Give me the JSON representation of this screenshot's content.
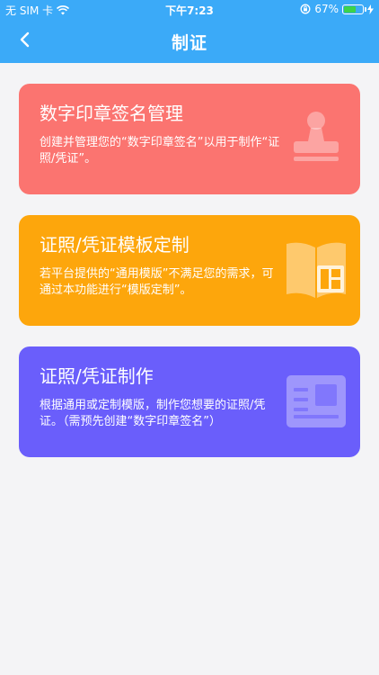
{
  "status_bar": {
    "carrier": "无 SIM 卡",
    "time": "下午7:23",
    "battery_text": "67%",
    "battery_level": 0.67,
    "wifi_icon": "wifi-icon",
    "lock_icon": "orientation-lock-icon"
  },
  "nav": {
    "title": "制证",
    "back_icon": "chevron-left-icon"
  },
  "cards": [
    {
      "title": "数字印章签名管理",
      "desc": "创建并管理您的“数字印章签名”以用于制作“证照/凭证”。",
      "color": "#fb7470",
      "icon": "stamp-icon"
    },
    {
      "title": "证照/凭证模板定制",
      "desc": "若平台提供的“通用模版”不满足您的需求，可通过本功能进行“模版定制”。",
      "color": "#fda60c",
      "icon": "template-book-icon"
    },
    {
      "title": "证照/凭证制作",
      "desc": "根据通用或定制模版，制作您想要的证照/凭证。（需预先创建“数字印章签名”）",
      "color": "#6a5efb",
      "icon": "id-card-icon"
    }
  ]
}
